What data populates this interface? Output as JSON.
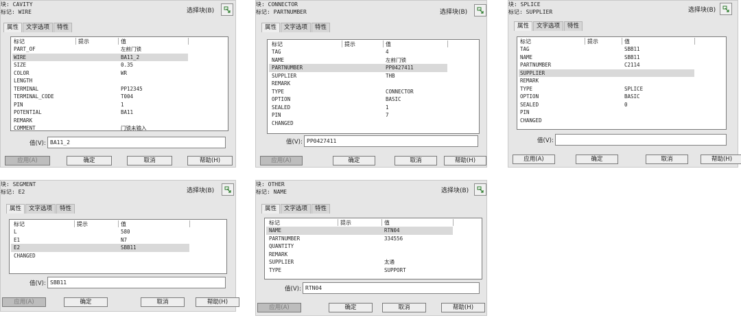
{
  "labels": {
    "block_prefix": "块: ",
    "tag_prefix": "标记: ",
    "select_block": "选择块(B)",
    "tabs": [
      "属性",
      "文字选项",
      "特性"
    ],
    "col_tag": "标记",
    "col_hint": "提示",
    "col_value": "值",
    "value_label": "值(V):",
    "apply": "应用(A)",
    "ok": "确定",
    "cancel": "取消",
    "help": "帮助(H)"
  },
  "dialogs": [
    {
      "block": "CAVITY",
      "tag": "WIRE",
      "rows": [
        [
          "PART_OF",
          "左前门锁"
        ],
        [
          "WIRE",
          "BA11_2"
        ],
        [
          "SIZE",
          "0.35"
        ],
        [
          "COLOR",
          "WR"
        ],
        [
          "LENGTH",
          ""
        ],
        [
          "TERMINAL",
          "PP12345"
        ],
        [
          "TERMINAL_CODE",
          "T004"
        ],
        [
          "PIN",
          "1"
        ],
        [
          "POTENTIAL",
          "BA11"
        ],
        [
          "REMARK",
          ""
        ],
        [
          "COMMENT",
          "门锁未输入"
        ]
      ],
      "selected": 1,
      "value": "BA11_2",
      "apply_disabled": true
    },
    {
      "block": "CONNECTOR",
      "tag": "PARTNUMBER",
      "rows": [
        [
          "TAG",
          "4"
        ],
        [
          "NAME",
          "左前门锁"
        ],
        [
          "PARTNUMBER",
          "PP0427411"
        ],
        [
          "SUPPLIER",
          "THB"
        ],
        [
          "REMARK",
          ""
        ],
        [
          "TYPE",
          "CONNECTOR"
        ],
        [
          "OPTION",
          "BASIC"
        ],
        [
          "SEALED",
          "1"
        ],
        [
          "PIN",
          "7"
        ],
        [
          "CHANGED",
          ""
        ]
      ],
      "selected": 2,
      "value": "PP0427411",
      "apply_disabled": true
    },
    {
      "block": "SPLICE",
      "tag": "SUPPLIER",
      "rows": [
        [
          "TAG",
          "SBB11"
        ],
        [
          "NAME",
          "SBB11"
        ],
        [
          "PARTNUMBER",
          "C2114"
        ],
        [
          "SUPPLIER",
          ""
        ],
        [
          "REMARK",
          ""
        ],
        [
          "TYPE",
          "SPLICE"
        ],
        [
          "OPTION",
          "BASIC"
        ],
        [
          "SEALED",
          "0"
        ],
        [
          "PIN",
          ""
        ],
        [
          "CHANGED",
          ""
        ]
      ],
      "selected": 3,
      "value": "",
      "apply_disabled": false
    },
    {
      "block": "SEGMENT",
      "tag": "E2",
      "rows": [
        [
          "L",
          "580"
        ],
        [
          "E1",
          "N7"
        ],
        [
          "E2",
          "SBB11"
        ],
        [
          "CHANGED",
          ""
        ]
      ],
      "selected": 2,
      "value": "SBB11",
      "apply_disabled": true
    },
    {
      "block": "OTHER",
      "tag": "NAME",
      "rows": [
        [
          "NAME",
          "RTN04"
        ],
        [
          "PARTNUMBER",
          "334556"
        ],
        [
          "QUANTITY",
          ""
        ],
        [
          "REMARK",
          ""
        ],
        [
          "SUPPLIER",
          "太通"
        ],
        [
          "TYPE",
          "SUPPORT"
        ]
      ],
      "selected": 0,
      "value": "RTN04",
      "apply_disabled": true
    }
  ]
}
